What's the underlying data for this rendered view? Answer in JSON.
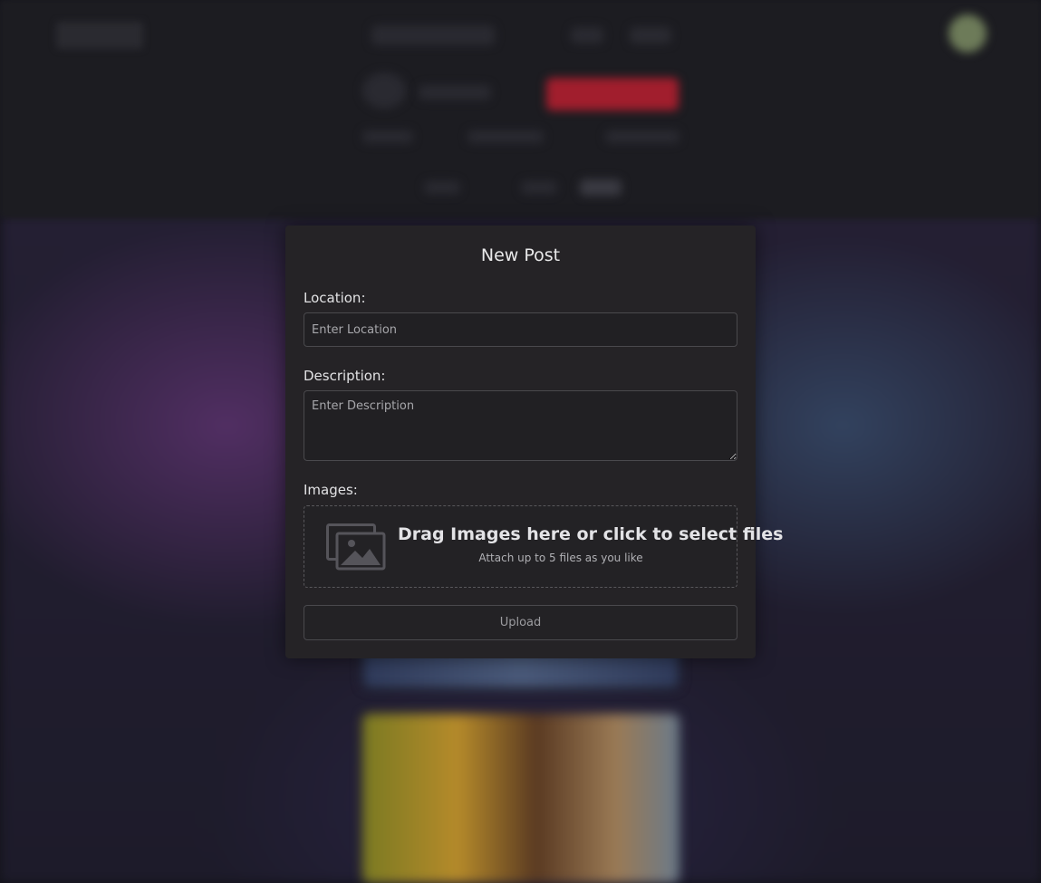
{
  "modal": {
    "title": "New Post",
    "location": {
      "label": "Location:",
      "placeholder": "Enter Location",
      "value": ""
    },
    "description": {
      "label": "Description:",
      "placeholder": "Enter Description",
      "value": ""
    },
    "images": {
      "label": "Images:",
      "dropzone_title": "Drag Images here or click to select files",
      "dropzone_subtitle": "Attach up to 5 files as you like",
      "icon": "images-icon"
    },
    "upload_label": "Upload"
  },
  "colors": {
    "modal_bg": "#252326",
    "accent_red": "#a11e2d",
    "avatar": "#6d7b59"
  }
}
